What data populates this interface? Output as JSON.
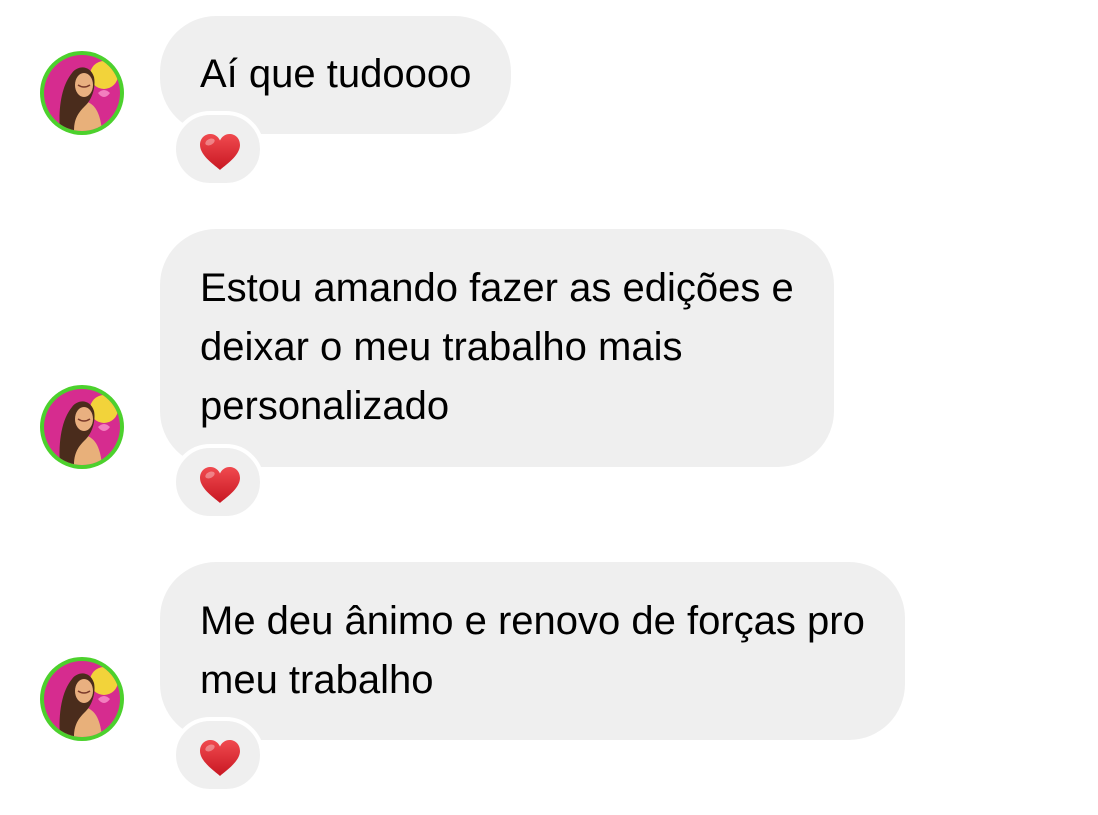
{
  "messages": [
    {
      "lines": [
        "Aí que tudoooo"
      ],
      "reaction": "heart-icon"
    },
    {
      "lines": [
        "Estou amando fazer as edições e",
        "deixar o meu trabalho mais",
        "personalizado"
      ],
      "reaction": "heart-icon"
    },
    {
      "lines": [
        "Me deu ânimo e renovo de forças pro",
        "meu trabalho"
      ],
      "reaction": "heart-icon"
    }
  ],
  "colors": {
    "bubble_background": "#efefef",
    "avatar_ring": "#4cd12d",
    "heart": "#e0242e",
    "text": "#000000"
  }
}
